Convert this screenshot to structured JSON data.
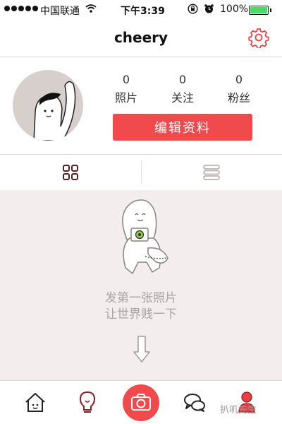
{
  "status_bar": {
    "carrier": "中国联通",
    "time": "下午3:39",
    "battery": "100%"
  },
  "nav": {
    "title": "cheery",
    "settings_icon": "gear-icon"
  },
  "profile": {
    "stats": [
      {
        "value": "0",
        "label": "照片"
      },
      {
        "value": "0",
        "label": "关注"
      },
      {
        "value": "0",
        "label": "粉丝"
      }
    ],
    "edit_button": "编辑资料"
  },
  "tabs": [
    {
      "icon": "grid-icon",
      "active": true
    },
    {
      "icon": "list-icon",
      "active": false
    }
  ],
  "empty_state": {
    "line1": "发第一张照片",
    "line2": "让世界贱一下"
  },
  "bottom_bar": {
    "items": [
      "home-icon",
      "lightbulb-icon",
      "camera-icon",
      "chat-icon",
      "profile-icon"
    ]
  },
  "watermark": "扒叽先生",
  "colors": {
    "accent": "#f04a4c",
    "content_bg": "#f4eded",
    "battery_green": "#4cd964"
  }
}
